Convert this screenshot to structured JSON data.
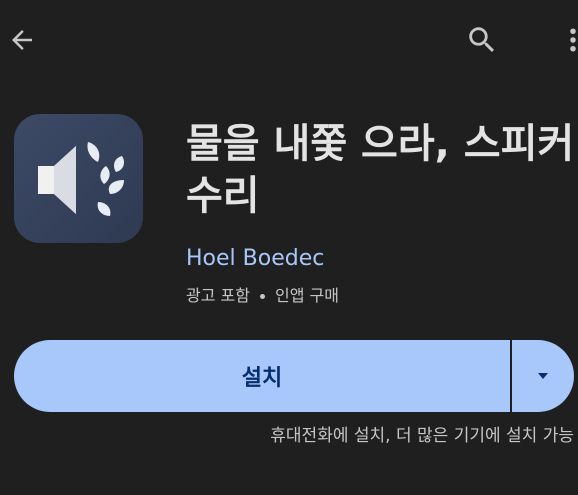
{
  "topbar": {
    "back_icon": "arrow-back-icon",
    "search_icon": "search-icon",
    "more_icon": "more-vert-icon"
  },
  "app": {
    "icon": "speaker-water-drops-icon",
    "title": "물을 내쫓 으라, 스피커\n수리",
    "developer": "Hoel Boedec",
    "meta_ads": "광고 포함",
    "meta_iap": "인앱 구매"
  },
  "install": {
    "label": "설치",
    "dropdown_icon": "caret-down-icon",
    "note": "휴대전화에 설치, 더 많은 기기에 설치 가능"
  },
  "colors": {
    "background": "#1f1f1f",
    "accent": "#a8c7fa",
    "button_text": "#062e6f",
    "text_primary": "#e3e3e3",
    "text_secondary": "#c4c7c5"
  }
}
